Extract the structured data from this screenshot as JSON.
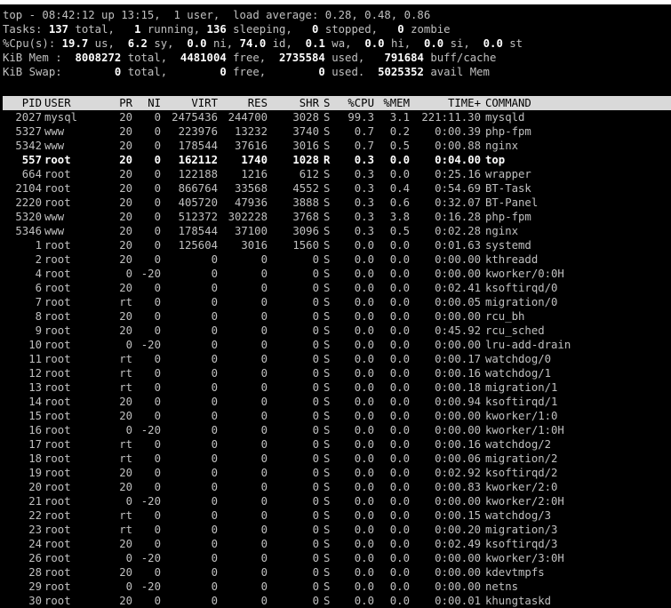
{
  "summary": {
    "line1": {
      "text": "top - 08:42:12 up 13:15,  1 user,  load average: 0.28, 0.48, 0.86"
    },
    "tasks": {
      "label": "Tasks:",
      "total": "137",
      "total_label": "total,",
      "running": "1",
      "running_label": "running,",
      "sleeping": "136",
      "sleeping_label": "sleeping,",
      "stopped": "0",
      "stopped_label": "stopped,",
      "zombie": "0",
      "zombie_label": "zombie"
    },
    "cpu": {
      "label": "%Cpu(s):",
      "us": "19.7",
      "us_label": "us,",
      "sy": "6.2",
      "sy_label": "sy,",
      "ni": "0.0",
      "ni_label": "ni,",
      "id": "74.0",
      "id_label": "id,",
      "wa": "0.1",
      "wa_label": "wa,",
      "hi": "0.0",
      "hi_label": "hi,",
      "si": "0.0",
      "si_label": "si,",
      "st": "0.0",
      "st_label": "st"
    },
    "mem": {
      "label": "KiB Mem :",
      "total": "8008272",
      "total_label": "total,",
      "free": "4481004",
      "free_label": "free,",
      "used": "2735584",
      "used_label": "used,",
      "buff": "791684",
      "buff_label": "buff/cache"
    },
    "swap": {
      "label": "KiB Swap:",
      "total": "0",
      "total_label": "total,",
      "free": "0",
      "free_label": "free,",
      "used": "0",
      "used_label": "used.",
      "avail": "5025352",
      "avail_label": "avail Mem"
    }
  },
  "columns": [
    "PID",
    "USER",
    "PR",
    "NI",
    "VIRT",
    "RES",
    "SHR",
    "S",
    "%CPU",
    "%MEM",
    "TIME+",
    "COMMAND"
  ],
  "processes": [
    {
      "pid": "2027",
      "user": "mysql",
      "pr": "20",
      "ni": "0",
      "virt": "2475436",
      "res": "244700",
      "shr": "3028",
      "s": "S",
      "cpu": "99.3",
      "mem": "3.1",
      "time": "221:11.30",
      "cmd": "mysqld",
      "bold": false
    },
    {
      "pid": "5327",
      "user": "www",
      "pr": "20",
      "ni": "0",
      "virt": "223976",
      "res": "13232",
      "shr": "3740",
      "s": "S",
      "cpu": "0.7",
      "mem": "0.2",
      "time": "0:00.39",
      "cmd": "php-fpm",
      "bold": false
    },
    {
      "pid": "5342",
      "user": "www",
      "pr": "20",
      "ni": "0",
      "virt": "178544",
      "res": "37616",
      "shr": "3016",
      "s": "S",
      "cpu": "0.7",
      "mem": "0.5",
      "time": "0:00.88",
      "cmd": "nginx",
      "bold": false
    },
    {
      "pid": "557",
      "user": "root",
      "pr": "20",
      "ni": "0",
      "virt": "162112",
      "res": "1740",
      "shr": "1028",
      "s": "R",
      "cpu": "0.3",
      "mem": "0.0",
      "time": "0:04.00",
      "cmd": "top",
      "bold": true
    },
    {
      "pid": "664",
      "user": "root",
      "pr": "20",
      "ni": "0",
      "virt": "122188",
      "res": "1216",
      "shr": "612",
      "s": "S",
      "cpu": "0.3",
      "mem": "0.0",
      "time": "0:25.16",
      "cmd": "wrapper",
      "bold": false
    },
    {
      "pid": "2104",
      "user": "root",
      "pr": "20",
      "ni": "0",
      "virt": "866764",
      "res": "33568",
      "shr": "4552",
      "s": "S",
      "cpu": "0.3",
      "mem": "0.4",
      "time": "0:54.69",
      "cmd": "BT-Task",
      "bold": false
    },
    {
      "pid": "2220",
      "user": "root",
      "pr": "20",
      "ni": "0",
      "virt": "405720",
      "res": "47936",
      "shr": "3888",
      "s": "S",
      "cpu": "0.3",
      "mem": "0.6",
      "time": "0:32.07",
      "cmd": "BT-Panel",
      "bold": false
    },
    {
      "pid": "5320",
      "user": "www",
      "pr": "20",
      "ni": "0",
      "virt": "512372",
      "res": "302228",
      "shr": "3768",
      "s": "S",
      "cpu": "0.3",
      "mem": "3.8",
      "time": "0:16.28",
      "cmd": "php-fpm",
      "bold": false
    },
    {
      "pid": "5346",
      "user": "www",
      "pr": "20",
      "ni": "0",
      "virt": "178544",
      "res": "37100",
      "shr": "3096",
      "s": "S",
      "cpu": "0.3",
      "mem": "0.5",
      "time": "0:02.28",
      "cmd": "nginx",
      "bold": false
    },
    {
      "pid": "1",
      "user": "root",
      "pr": "20",
      "ni": "0",
      "virt": "125604",
      "res": "3016",
      "shr": "1560",
      "s": "S",
      "cpu": "0.0",
      "mem": "0.0",
      "time": "0:01.63",
      "cmd": "systemd",
      "bold": false
    },
    {
      "pid": "2",
      "user": "root",
      "pr": "20",
      "ni": "0",
      "virt": "0",
      "res": "0",
      "shr": "0",
      "s": "S",
      "cpu": "0.0",
      "mem": "0.0",
      "time": "0:00.00",
      "cmd": "kthreadd",
      "bold": false
    },
    {
      "pid": "4",
      "user": "root",
      "pr": "0",
      "ni": "-20",
      "virt": "0",
      "res": "0",
      "shr": "0",
      "s": "S",
      "cpu": "0.0",
      "mem": "0.0",
      "time": "0:00.00",
      "cmd": "kworker/0:0H",
      "bold": false
    },
    {
      "pid": "6",
      "user": "root",
      "pr": "20",
      "ni": "0",
      "virt": "0",
      "res": "0",
      "shr": "0",
      "s": "S",
      "cpu": "0.0",
      "mem": "0.0",
      "time": "0:02.41",
      "cmd": "ksoftirqd/0",
      "bold": false
    },
    {
      "pid": "7",
      "user": "root",
      "pr": "rt",
      "ni": "0",
      "virt": "0",
      "res": "0",
      "shr": "0",
      "s": "S",
      "cpu": "0.0",
      "mem": "0.0",
      "time": "0:00.05",
      "cmd": "migration/0",
      "bold": false
    },
    {
      "pid": "8",
      "user": "root",
      "pr": "20",
      "ni": "0",
      "virt": "0",
      "res": "0",
      "shr": "0",
      "s": "S",
      "cpu": "0.0",
      "mem": "0.0",
      "time": "0:00.00",
      "cmd": "rcu_bh",
      "bold": false
    },
    {
      "pid": "9",
      "user": "root",
      "pr": "20",
      "ni": "0",
      "virt": "0",
      "res": "0",
      "shr": "0",
      "s": "S",
      "cpu": "0.0",
      "mem": "0.0",
      "time": "0:45.92",
      "cmd": "rcu_sched",
      "bold": false
    },
    {
      "pid": "10",
      "user": "root",
      "pr": "0",
      "ni": "-20",
      "virt": "0",
      "res": "0",
      "shr": "0",
      "s": "S",
      "cpu": "0.0",
      "mem": "0.0",
      "time": "0:00.00",
      "cmd": "lru-add-drain",
      "bold": false
    },
    {
      "pid": "11",
      "user": "root",
      "pr": "rt",
      "ni": "0",
      "virt": "0",
      "res": "0",
      "shr": "0",
      "s": "S",
      "cpu": "0.0",
      "mem": "0.0",
      "time": "0:00.17",
      "cmd": "watchdog/0",
      "bold": false
    },
    {
      "pid": "12",
      "user": "root",
      "pr": "rt",
      "ni": "0",
      "virt": "0",
      "res": "0",
      "shr": "0",
      "s": "S",
      "cpu": "0.0",
      "mem": "0.0",
      "time": "0:00.16",
      "cmd": "watchdog/1",
      "bold": false
    },
    {
      "pid": "13",
      "user": "root",
      "pr": "rt",
      "ni": "0",
      "virt": "0",
      "res": "0",
      "shr": "0",
      "s": "S",
      "cpu": "0.0",
      "mem": "0.0",
      "time": "0:00.18",
      "cmd": "migration/1",
      "bold": false
    },
    {
      "pid": "14",
      "user": "root",
      "pr": "20",
      "ni": "0",
      "virt": "0",
      "res": "0",
      "shr": "0",
      "s": "S",
      "cpu": "0.0",
      "mem": "0.0",
      "time": "0:00.94",
      "cmd": "ksoftirqd/1",
      "bold": false
    },
    {
      "pid": "15",
      "user": "root",
      "pr": "20",
      "ni": "0",
      "virt": "0",
      "res": "0",
      "shr": "0",
      "s": "S",
      "cpu": "0.0",
      "mem": "0.0",
      "time": "0:00.00",
      "cmd": "kworker/1:0",
      "bold": false
    },
    {
      "pid": "16",
      "user": "root",
      "pr": "0",
      "ni": "-20",
      "virt": "0",
      "res": "0",
      "shr": "0",
      "s": "S",
      "cpu": "0.0",
      "mem": "0.0",
      "time": "0:00.00",
      "cmd": "kworker/1:0H",
      "bold": false
    },
    {
      "pid": "17",
      "user": "root",
      "pr": "rt",
      "ni": "0",
      "virt": "0",
      "res": "0",
      "shr": "0",
      "s": "S",
      "cpu": "0.0",
      "mem": "0.0",
      "time": "0:00.16",
      "cmd": "watchdog/2",
      "bold": false
    },
    {
      "pid": "18",
      "user": "root",
      "pr": "rt",
      "ni": "0",
      "virt": "0",
      "res": "0",
      "shr": "0",
      "s": "S",
      "cpu": "0.0",
      "mem": "0.0",
      "time": "0:00.06",
      "cmd": "migration/2",
      "bold": false
    },
    {
      "pid": "19",
      "user": "root",
      "pr": "20",
      "ni": "0",
      "virt": "0",
      "res": "0",
      "shr": "0",
      "s": "S",
      "cpu": "0.0",
      "mem": "0.0",
      "time": "0:02.92",
      "cmd": "ksoftirqd/2",
      "bold": false
    },
    {
      "pid": "20",
      "user": "root",
      "pr": "20",
      "ni": "0",
      "virt": "0",
      "res": "0",
      "shr": "0",
      "s": "S",
      "cpu": "0.0",
      "mem": "0.0",
      "time": "0:00.83",
      "cmd": "kworker/2:0",
      "bold": false
    },
    {
      "pid": "21",
      "user": "root",
      "pr": "0",
      "ni": "-20",
      "virt": "0",
      "res": "0",
      "shr": "0",
      "s": "S",
      "cpu": "0.0",
      "mem": "0.0",
      "time": "0:00.00",
      "cmd": "kworker/2:0H",
      "bold": false
    },
    {
      "pid": "22",
      "user": "root",
      "pr": "rt",
      "ni": "0",
      "virt": "0",
      "res": "0",
      "shr": "0",
      "s": "S",
      "cpu": "0.0",
      "mem": "0.0",
      "time": "0:00.15",
      "cmd": "watchdog/3",
      "bold": false
    },
    {
      "pid": "23",
      "user": "root",
      "pr": "rt",
      "ni": "0",
      "virt": "0",
      "res": "0",
      "shr": "0",
      "s": "S",
      "cpu": "0.0",
      "mem": "0.0",
      "time": "0:00.20",
      "cmd": "migration/3",
      "bold": false
    },
    {
      "pid": "24",
      "user": "root",
      "pr": "20",
      "ni": "0",
      "virt": "0",
      "res": "0",
      "shr": "0",
      "s": "S",
      "cpu": "0.0",
      "mem": "0.0",
      "time": "0:02.49",
      "cmd": "ksoftirqd/3",
      "bold": false
    },
    {
      "pid": "26",
      "user": "root",
      "pr": "0",
      "ni": "-20",
      "virt": "0",
      "res": "0",
      "shr": "0",
      "s": "S",
      "cpu": "0.0",
      "mem": "0.0",
      "time": "0:00.00",
      "cmd": "kworker/3:0H",
      "bold": false
    },
    {
      "pid": "28",
      "user": "root",
      "pr": "20",
      "ni": "0",
      "virt": "0",
      "res": "0",
      "shr": "0",
      "s": "S",
      "cpu": "0.0",
      "mem": "0.0",
      "time": "0:00.00",
      "cmd": "kdevtmpfs",
      "bold": false
    },
    {
      "pid": "29",
      "user": "root",
      "pr": "0",
      "ni": "-20",
      "virt": "0",
      "res": "0",
      "shr": "0",
      "s": "S",
      "cpu": "0.0",
      "mem": "0.0",
      "time": "0:00.00",
      "cmd": "netns",
      "bold": false
    },
    {
      "pid": "30",
      "user": "root",
      "pr": "20",
      "ni": "0",
      "virt": "0",
      "res": "0",
      "shr": "0",
      "s": "S",
      "cpu": "0.0",
      "mem": "0.0",
      "time": "0:00.01",
      "cmd": "khungtaskd",
      "bold": false
    }
  ],
  "colors": {
    "background": "#000000",
    "text": "#c0c0c0",
    "bold_text": "#ffffff",
    "header_bg": "#d9d9d9",
    "header_text": "#000000"
  }
}
